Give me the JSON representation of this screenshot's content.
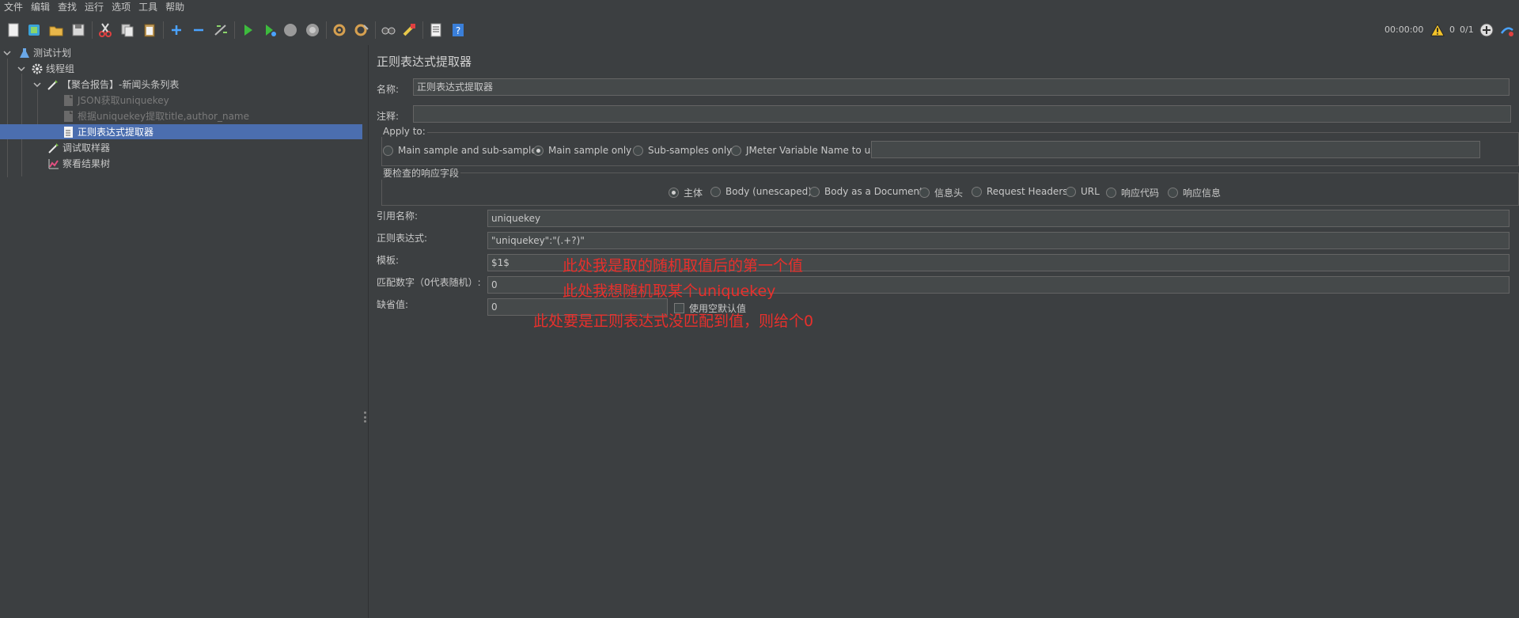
{
  "menu": [
    "文件",
    "编辑",
    "查找",
    "运行",
    "选项",
    "工具",
    "帮助"
  ],
  "toolbar": {
    "icons": [
      "new-icon",
      "templates-icon",
      "open-icon",
      "save-icon",
      "cut-icon",
      "copy-icon",
      "paste-icon",
      "expand-icon",
      "collapse-icon",
      "toggle-icon",
      "start-icon",
      "start-no-pause-icon",
      "stop-icon",
      "shutdown-icon",
      "clear-icon",
      "clear-all-icon",
      "search-icon",
      "reset-search-icon",
      "function-helper-icon",
      "help-icon"
    ],
    "elapsed": "00:00:00",
    "warnings": "0",
    "threads": "0/1"
  },
  "tree": {
    "items": [
      {
        "label": "测试计划",
        "icon": "test-plan-icon",
        "enabled": true,
        "selected": false
      },
      {
        "label": "线程组",
        "icon": "gear-icon",
        "enabled": true,
        "selected": false
      },
      {
        "label": "【聚合报告】-新闻头条列表",
        "icon": "sampler-icon",
        "enabled": true,
        "selected": false
      },
      {
        "label": "JSON获取uniquekey",
        "icon": "extractor-icon",
        "enabled": false,
        "selected": false
      },
      {
        "label": "根据uniquekey提取title,author_name",
        "icon": "extractor-icon",
        "enabled": false,
        "selected": false
      },
      {
        "label": "正则表达式提取器",
        "icon": "extractor-icon",
        "enabled": true,
        "selected": true
      },
      {
        "label": "调试取样器",
        "icon": "sampler-icon",
        "enabled": true,
        "selected": false
      },
      {
        "label": "察看结果树",
        "icon": "listener-icon",
        "enabled": true,
        "selected": false
      }
    ]
  },
  "panel": {
    "title": "正则表达式提取器",
    "name_label": "名称:",
    "name_value": "正则表达式提取器",
    "comment_label": "注释:",
    "comment_value": "",
    "apply_to": {
      "label": "Apply to:",
      "options": [
        "Main sample and sub-samples",
        "Main sample only",
        "Sub-samples only",
        "JMeter Variable Name to use"
      ],
      "selected": 1,
      "var_value": ""
    },
    "field_check": {
      "label": "要检查的响应字段",
      "options": [
        "主体",
        "Body (unescaped)",
        "Body as a Document",
        "信息头",
        "Request Headers",
        "URL",
        "响应代码",
        "响应信息"
      ],
      "selected": 0
    },
    "ref_label": "引用名称:",
    "ref_value": "uniquekey",
    "regex_label": "正则表达式:",
    "regex_value": "\"uniquekey\":\"(.+?)\"",
    "template_label": "模板:",
    "template_value": "$1$",
    "match_label": "匹配数字（0代表随机）:",
    "match_value": "0",
    "default_label": "缺省值:",
    "default_value": "0",
    "empty_default_label": "使用空默认值"
  },
  "annotations": {
    "a1": "此处我是取的随机取值后的第一个值",
    "a2": "此处我想随机取某个uniquekey",
    "a3": "此处要是正则表达式没匹配到值，则给个0"
  }
}
